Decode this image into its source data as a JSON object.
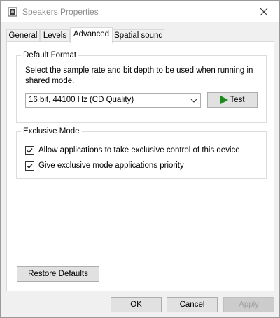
{
  "window": {
    "title": "Speakers Properties",
    "icon": "speaker-icon",
    "close_icon": "close-icon"
  },
  "tabs": [
    {
      "label": "General",
      "active": false
    },
    {
      "label": "Levels",
      "active": false
    },
    {
      "label": "Advanced",
      "active": true
    },
    {
      "label": "Spatial sound",
      "active": false
    }
  ],
  "default_format": {
    "legend": "Default Format",
    "description": "Select the sample rate and bit depth to be used when running in shared mode.",
    "selected_format": "16 bit, 44100 Hz (CD Quality)",
    "test_label": "Test",
    "test_icon": "play-icon",
    "play_color": "#1a8a1a"
  },
  "exclusive_mode": {
    "legend": "Exclusive Mode",
    "options": [
      {
        "label": "Allow applications to take exclusive control of this device",
        "checked": true
      },
      {
        "label": "Give exclusive mode applications priority",
        "checked": true
      }
    ]
  },
  "restore_defaults_label": "Restore Defaults",
  "footer": {
    "ok_label": "OK",
    "cancel_label": "Cancel",
    "apply_label": "Apply",
    "apply_enabled": false
  }
}
